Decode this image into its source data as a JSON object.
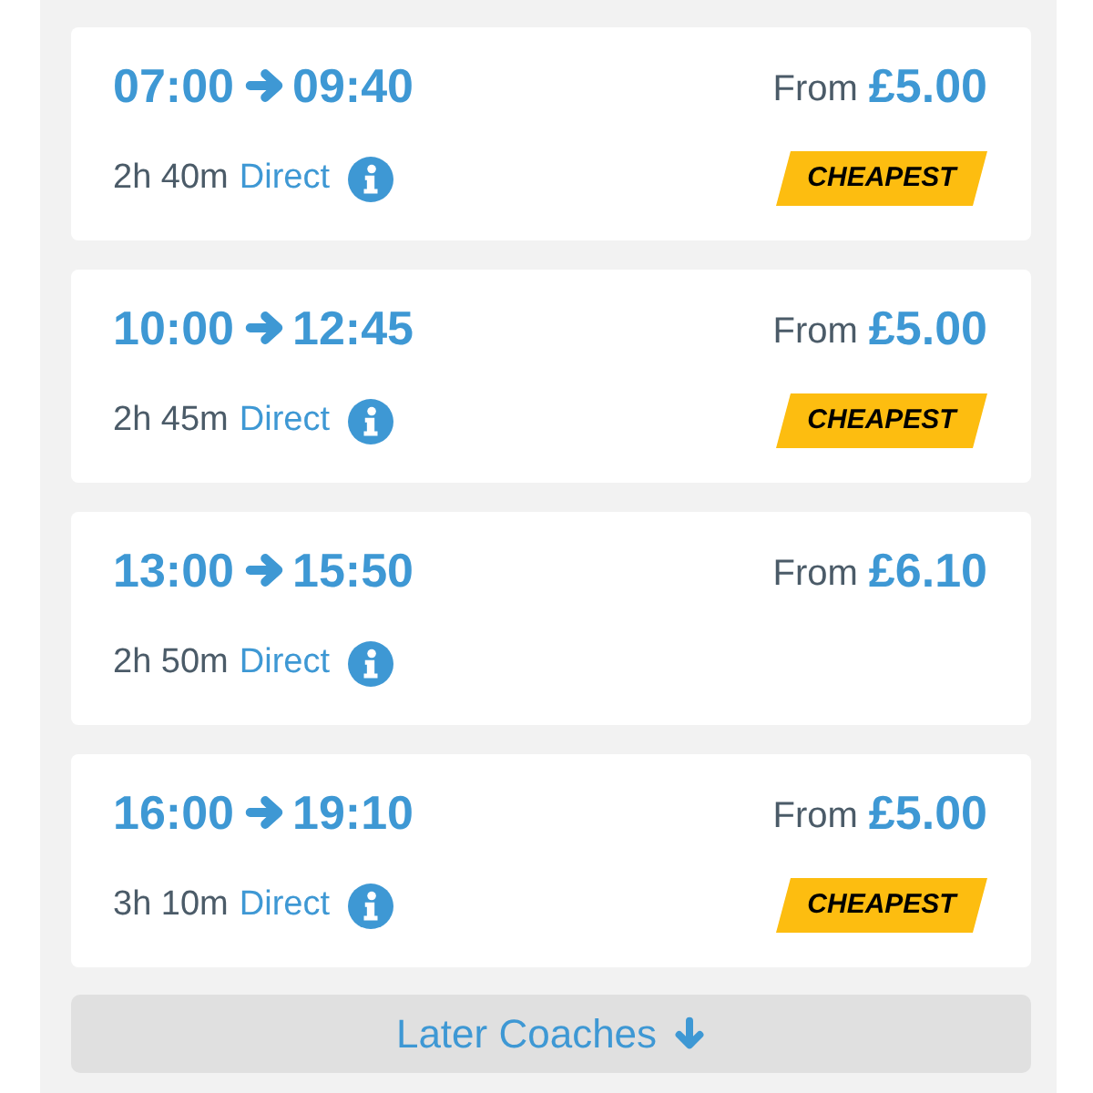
{
  "journeys": [
    {
      "departure": "07:00",
      "arrival": "09:40",
      "price_label": "From",
      "price": "£5.00",
      "duration": "2h 40m",
      "route_type": "Direct",
      "badge": "CHEAPEST"
    },
    {
      "departure": "10:00",
      "arrival": "12:45",
      "price_label": "From",
      "price": "£5.00",
      "duration": "2h 45m",
      "route_type": "Direct",
      "badge": "CHEAPEST"
    },
    {
      "departure": "13:00",
      "arrival": "15:50",
      "price_label": "From",
      "price": "£6.10",
      "duration": "2h 50m",
      "route_type": "Direct"
    },
    {
      "departure": "16:00",
      "arrival": "19:10",
      "price_label": "From",
      "price": "£5.00",
      "duration": "3h 10m",
      "route_type": "Direct",
      "badge": "CHEAPEST"
    }
  ],
  "later_button": {
    "label": "Later Coaches"
  }
}
